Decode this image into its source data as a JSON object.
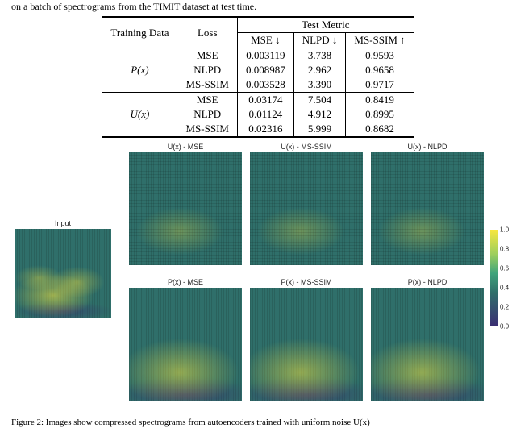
{
  "caption_top_fragment": "on a batch of spectrograms from the TIMIT dataset at test time.",
  "table": {
    "header_training": "Training Data",
    "header_loss": "Loss",
    "header_metric_group": "Test Metric",
    "col_mse": "MSE ↓",
    "col_nlpd": "NLPD ↓",
    "col_msssim": "MS-SSIM ↑",
    "groups": [
      {
        "name": "P(x)",
        "rows": [
          {
            "loss": "MSE",
            "mse": "0.003119",
            "mse_bold": true,
            "nlpd": "3.738",
            "nlpd_bold": false,
            "ms": "0.9593",
            "ms_bold": false
          },
          {
            "loss": "NLPD",
            "mse": "0.008987",
            "mse_bold": false,
            "nlpd": "2.962",
            "nlpd_bold": true,
            "ms": "0.9658",
            "ms_bold": false
          },
          {
            "loss": "MS-SSIM",
            "mse": "0.003528",
            "mse_bold": false,
            "nlpd": "3.390",
            "nlpd_bold": false,
            "ms": "0.9717",
            "ms_bold": true
          }
        ]
      },
      {
        "name": "U(x)",
        "rows": [
          {
            "loss": "MSE",
            "mse": "0.03174",
            "mse_bold": false,
            "nlpd": "7.504",
            "nlpd_bold": false,
            "ms": "0.8419",
            "ms_bold": false
          },
          {
            "loss": "NLPD",
            "mse": "0.01124",
            "mse_bold": true,
            "nlpd": "4.912",
            "nlpd_bold": true,
            "ms": "0.8995",
            "ms_bold": true
          },
          {
            "loss": "MS-SSIM",
            "mse": "0.02316",
            "mse_bold": false,
            "nlpd": "5.999",
            "nlpd_bold": false,
            "ms": "0.8682",
            "ms_bold": false
          }
        ]
      }
    ]
  },
  "figure": {
    "input_label": "Input",
    "row_u": {
      "mse": "U(x) - MSE",
      "msssim": "U(x) - MS-SSIM",
      "nlpd": "U(x) - NLPD"
    },
    "row_p": {
      "mse": "P(x) - MSE",
      "msssim": "P(x) - MS-SSIM",
      "nlpd": "P(x) - NLPD"
    },
    "colorbar_ticks": [
      "1.0",
      "0.8",
      "0.6",
      "0.4",
      "0.2",
      "0.0"
    ]
  },
  "caption_bottom_fragment": "Figure 2: Images show compressed spectrograms from autoencoders trained with uniform noise U(x)"
}
